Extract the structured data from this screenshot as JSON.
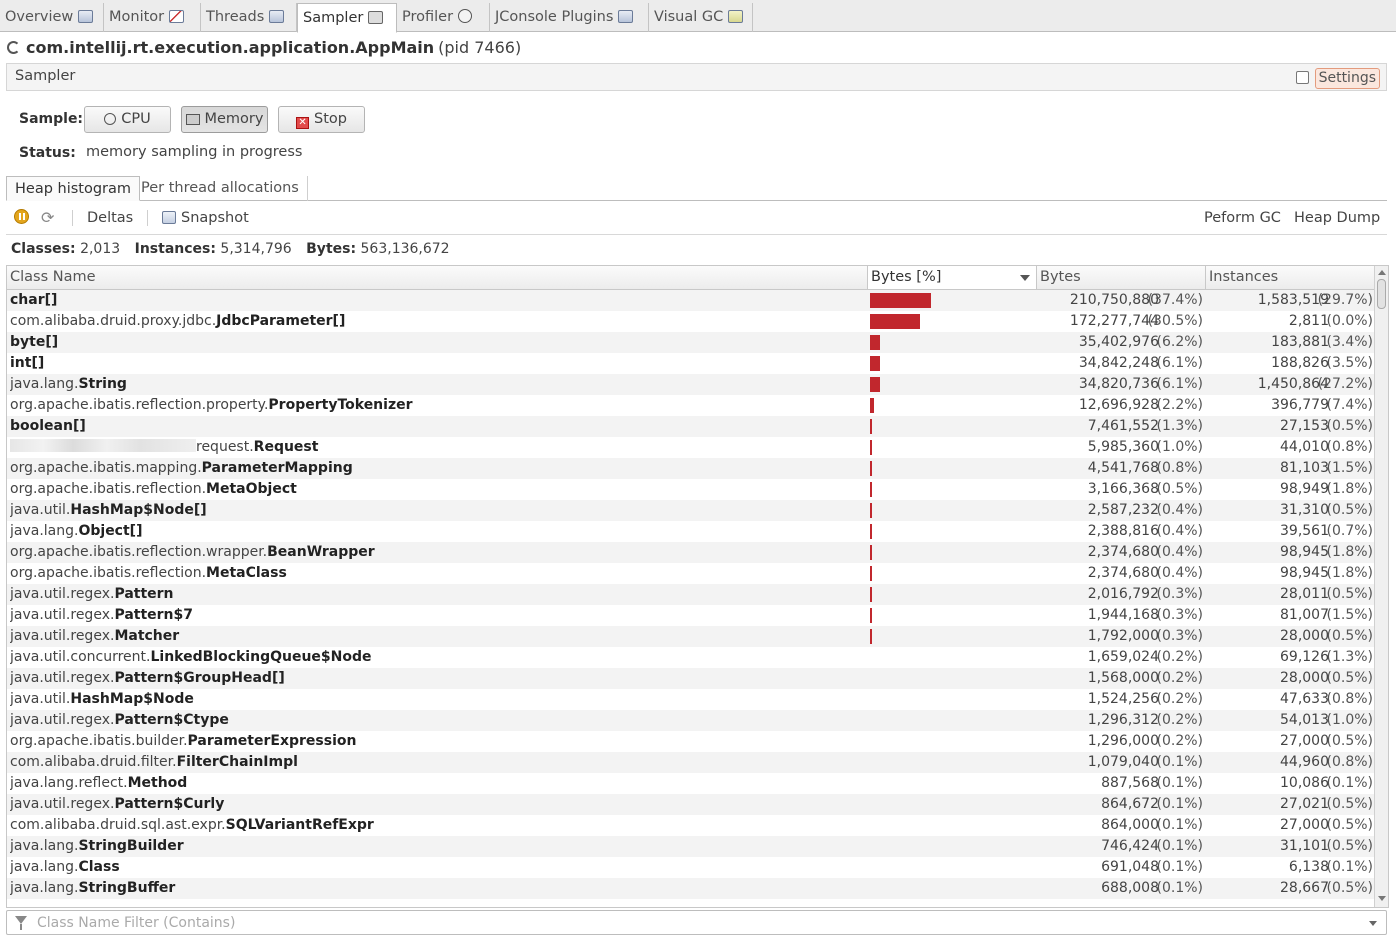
{
  "tabs": [
    {
      "label": "Overview",
      "icon": "overview-icon"
    },
    {
      "label": "Monitor",
      "icon": "monitor-chart-icon"
    },
    {
      "label": "Threads",
      "icon": "threads-icon"
    },
    {
      "label": "Sampler",
      "icon": "sampler-icon",
      "active": true
    },
    {
      "label": "Profiler",
      "icon": "profiler-clock-icon"
    },
    {
      "label": "JConsole Plugins",
      "icon": "jconsole-icon"
    },
    {
      "label": "Visual GC",
      "icon": "visual-gc-icon"
    }
  ],
  "app": {
    "title": "com.intellij.rt.execution.application.AppMain",
    "pid": "(pid 7466)"
  },
  "sampler": {
    "header": "Sampler",
    "settings_label": "Settings"
  },
  "controls": {
    "sample_label": "Sample:",
    "cpu_label": "CPU",
    "memory_label": "Memory",
    "stop_label": "Stop",
    "status_label": "Status:",
    "status_value": "memory sampling in progress"
  },
  "subtabs": {
    "heap": "Heap histogram",
    "per_thread": "Per thread allocations"
  },
  "toolbar": {
    "deltas": "Deltas",
    "snapshot": "Snapshot",
    "perform_gc": "Peform GC",
    "heap_dump": "Heap Dump"
  },
  "summary": {
    "classes_label": "Classes:",
    "classes": "2,013",
    "instances_label": "Instances:",
    "instances": "5,314,796",
    "bytes_label": "Bytes:",
    "bytes": "563,136,672"
  },
  "columns": {
    "class_name": "Class Name",
    "bytes_pct": "Bytes [%]",
    "bytes": "Bytes",
    "instances": "Instances"
  },
  "accent": "#c1272d",
  "rows": [
    {
      "pkg": "",
      "cls": "char[]",
      "bytes": "210,750,880",
      "bpct": "(37.4%)",
      "inst": "1,583,519",
      "ipct": "(29.7%)",
      "share": 37.4
    },
    {
      "pkg": "com.alibaba.druid.proxy.jdbc.",
      "cls": "JdbcParameter[]",
      "bytes": "172,277,744",
      "bpct": "(30.5%)",
      "inst": "2,811",
      "ipct": "(0.0%)",
      "share": 30.5
    },
    {
      "pkg": "",
      "cls": "byte[]",
      "bytes": "35,402,976",
      "bpct": "(6.2%)",
      "inst": "183,881",
      "ipct": "(3.4%)",
      "share": 6.2
    },
    {
      "pkg": "",
      "cls": "int[]",
      "bytes": "34,842,248",
      "bpct": "(6.1%)",
      "inst": "188,826",
      "ipct": "(3.5%)",
      "share": 6.1
    },
    {
      "pkg": "java.lang.",
      "cls": "String",
      "bytes": "34,820,736",
      "bpct": "(6.1%)",
      "inst": "1,450,864",
      "ipct": "(27.2%)",
      "share": 6.1
    },
    {
      "pkg": "org.apache.ibatis.reflection.property.",
      "cls": "PropertyTokenizer",
      "bytes": "12,696,928",
      "bpct": "(2.2%)",
      "inst": "396,779",
      "ipct": "(7.4%)",
      "share": 2.2
    },
    {
      "pkg": "",
      "cls": "boolean[]",
      "bytes": "7,461,552",
      "bpct": "(1.3%)",
      "inst": "27,153",
      "ipct": "(0.5%)",
      "share": 1.3
    },
    {
      "pkg": "request.",
      "cls": "Request",
      "bytes": "5,985,360",
      "bpct": "(1.0%)",
      "inst": "44,010",
      "ipct": "(0.8%)",
      "share": 1.0,
      "redacted": true
    },
    {
      "pkg": "org.apache.ibatis.mapping.",
      "cls": "ParameterMapping",
      "bytes": "4,541,768",
      "bpct": "(0.8%)",
      "inst": "81,103",
      "ipct": "(1.5%)",
      "share": 0.8
    },
    {
      "pkg": "org.apache.ibatis.reflection.",
      "cls": "MetaObject",
      "bytes": "3,166,368",
      "bpct": "(0.5%)",
      "inst": "98,949",
      "ipct": "(1.8%)",
      "share": 0.5
    },
    {
      "pkg": "java.util.",
      "cls": "HashMap$Node[]",
      "bytes": "2,587,232",
      "bpct": "(0.4%)",
      "inst": "31,310",
      "ipct": "(0.5%)",
      "share": 0.4
    },
    {
      "pkg": "java.lang.",
      "cls": "Object[]",
      "bytes": "2,388,816",
      "bpct": "(0.4%)",
      "inst": "39,561",
      "ipct": "(0.7%)",
      "share": 0.4
    },
    {
      "pkg": "org.apache.ibatis.reflection.wrapper.",
      "cls": "BeanWrapper",
      "bytes": "2,374,680",
      "bpct": "(0.4%)",
      "inst": "98,945",
      "ipct": "(1.8%)",
      "share": 0.4
    },
    {
      "pkg": "org.apache.ibatis.reflection.",
      "cls": "MetaClass",
      "bytes": "2,374,680",
      "bpct": "(0.4%)",
      "inst": "98,945",
      "ipct": "(1.8%)",
      "share": 0.4
    },
    {
      "pkg": "java.util.regex.",
      "cls": "Pattern",
      "bytes": "2,016,792",
      "bpct": "(0.3%)",
      "inst": "28,011",
      "ipct": "(0.5%)",
      "share": 0.3
    },
    {
      "pkg": "java.util.regex.",
      "cls": "Pattern$7",
      "bytes": "1,944,168",
      "bpct": "(0.3%)",
      "inst": "81,007",
      "ipct": "(1.5%)",
      "share": 0.3
    },
    {
      "pkg": "java.util.regex.",
      "cls": "Matcher",
      "bytes": "1,792,000",
      "bpct": "(0.3%)",
      "inst": "28,000",
      "ipct": "(0.5%)",
      "share": 0.3
    },
    {
      "pkg": "java.util.concurrent.",
      "cls": "LinkedBlockingQueue$Node",
      "bytes": "1,659,024",
      "bpct": "(0.2%)",
      "inst": "69,126",
      "ipct": "(1.3%)",
      "share": 0.2
    },
    {
      "pkg": "java.util.regex.",
      "cls": "Pattern$GroupHead[]",
      "bytes": "1,568,000",
      "bpct": "(0.2%)",
      "inst": "28,000",
      "ipct": "(0.5%)",
      "share": 0.2
    },
    {
      "pkg": "java.util.",
      "cls": "HashMap$Node",
      "bytes": "1,524,256",
      "bpct": "(0.2%)",
      "inst": "47,633",
      "ipct": "(0.8%)",
      "share": 0.2
    },
    {
      "pkg": "java.util.regex.",
      "cls": "Pattern$Ctype",
      "bytes": "1,296,312",
      "bpct": "(0.2%)",
      "inst": "54,013",
      "ipct": "(1.0%)",
      "share": 0.2
    },
    {
      "pkg": "org.apache.ibatis.builder.",
      "cls": "ParameterExpression",
      "bytes": "1,296,000",
      "bpct": "(0.2%)",
      "inst": "27,000",
      "ipct": "(0.5%)",
      "share": 0.2
    },
    {
      "pkg": "com.alibaba.druid.filter.",
      "cls": "FilterChainImpl",
      "bytes": "1,079,040",
      "bpct": "(0.1%)",
      "inst": "44,960",
      "ipct": "(0.8%)",
      "share": 0.1
    },
    {
      "pkg": "java.lang.reflect.",
      "cls": "Method",
      "bytes": "887,568",
      "bpct": "(0.1%)",
      "inst": "10,086",
      "ipct": "(0.1%)",
      "share": 0.1
    },
    {
      "pkg": "java.util.regex.",
      "cls": "Pattern$Curly",
      "bytes": "864,672",
      "bpct": "(0.1%)",
      "inst": "27,021",
      "ipct": "(0.5%)",
      "share": 0.1
    },
    {
      "pkg": "com.alibaba.druid.sql.ast.expr.",
      "cls": "SQLVariantRefExpr",
      "bytes": "864,000",
      "bpct": "(0.1%)",
      "inst": "27,000",
      "ipct": "(0.5%)",
      "share": 0.1
    },
    {
      "pkg": "java.lang.",
      "cls": "StringBuilder",
      "bytes": "746,424",
      "bpct": "(0.1%)",
      "inst": "31,101",
      "ipct": "(0.5%)",
      "share": 0.1
    },
    {
      "pkg": "java.lang.",
      "cls": "Class",
      "bytes": "691,048",
      "bpct": "(0.1%)",
      "inst": "6,138",
      "ipct": "(0.1%)",
      "share": 0.1
    },
    {
      "pkg": "java.lang.",
      "cls": "StringBuffer",
      "bytes": "688,008",
      "bpct": "(0.1%)",
      "inst": "28,667",
      "ipct": "(0.5%)",
      "share": 0.1
    }
  ],
  "filter": {
    "placeholder": "Class Name Filter (Contains)",
    "value": ""
  }
}
